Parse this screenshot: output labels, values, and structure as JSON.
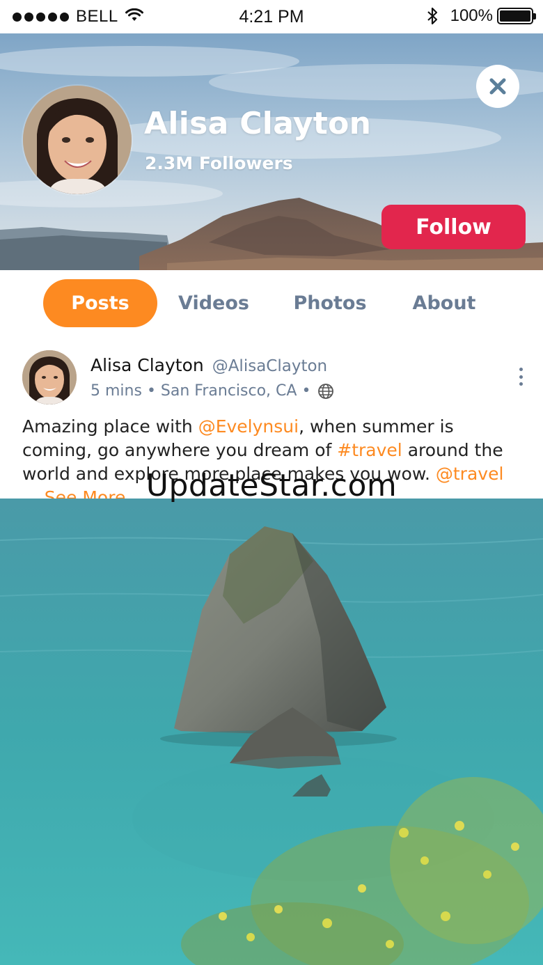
{
  "status_bar": {
    "carrier": "BELL",
    "time": "4:21 PM",
    "battery": "100%"
  },
  "profile": {
    "name": "Alisa Clayton",
    "followers": "2.3M Followers",
    "follow_label": "Follow"
  },
  "tabs": [
    {
      "label": "Posts",
      "active": true
    },
    {
      "label": "Videos",
      "active": false
    },
    {
      "label": "Photos",
      "active": false
    },
    {
      "label": "About",
      "active": false
    }
  ],
  "post": {
    "author": "Alisa Clayton",
    "handle": "@AlisaClayton",
    "time": "5 mins",
    "location": "San Francisco, CA",
    "text": {
      "part1": "Amazing place with ",
      "mention1": "@Evelynsui",
      "part2": ", when summer is coming, go anywhere you dream of ",
      "hashtag": "#travel",
      "part3": " around the world and explore more place makes you wow. ",
      "mention2": "@travel",
      "see_more": " ... See More"
    }
  },
  "watermark": "UpdateStar.com",
  "colors": {
    "accent": "#fd8a21",
    "follow": "#e2264d",
    "muted": "#6a7c94"
  }
}
